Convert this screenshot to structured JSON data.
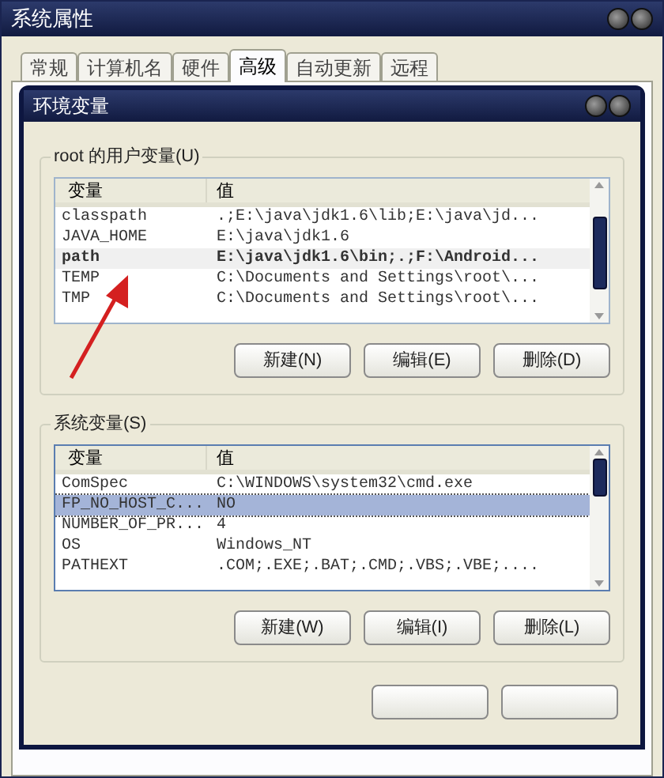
{
  "window": {
    "title": "系统属性"
  },
  "tabs": [
    {
      "label": "常规",
      "selected": false
    },
    {
      "label": "计算机名",
      "selected": false
    },
    {
      "label": "硬件",
      "selected": false
    },
    {
      "label": "高级",
      "selected": true
    },
    {
      "label": "自动更新",
      "selected": false
    },
    {
      "label": "远程",
      "selected": false
    }
  ],
  "dialog": {
    "title": "环境变量"
  },
  "groups": [
    {
      "title": "root 的用户变量(U)",
      "focused": false,
      "columns": [
        "变量",
        "值"
      ],
      "rows": [
        {
          "name": "classpath",
          "value": ".;E:\\java\\jdk1.6\\lib;E:\\java\\jd...",
          "selected": false
        },
        {
          "name": "JAVA_HOME",
          "value": "E:\\java\\jdk1.6",
          "selected": false
        },
        {
          "name": "path",
          "value": "E:\\java\\jdk1.6\\bin;.;F:\\Android...",
          "selected": true
        },
        {
          "name": "TEMP",
          "value": "C:\\Documents and Settings\\root\\...",
          "selected": false
        },
        {
          "name": "TMP",
          "value": "C:\\Documents and Settings\\root\\...",
          "selected": false
        }
      ],
      "buttons": [
        "新建(N)",
        "编辑(E)",
        "删除(D)"
      ]
    },
    {
      "title": "系统变量(S)",
      "focused": true,
      "columns": [
        "变量",
        "值"
      ],
      "rows": [
        {
          "name": "ComSpec",
          "value": "C:\\WINDOWS\\system32\\cmd.exe",
          "selected": false
        },
        {
          "name": "FP_NO_HOST_C...",
          "value": "NO",
          "selected": true
        },
        {
          "name": "NUMBER_OF_PR...",
          "value": "4",
          "selected": false
        },
        {
          "name": "OS",
          "value": "Windows_NT",
          "selected": false
        },
        {
          "name": "PATHEXT",
          "value": ".COM;.EXE;.BAT;.CMD;.VBS;.VBE;....",
          "selected": false
        }
      ],
      "buttons": [
        "新建(W)",
        "编辑(I)",
        "删除(L)"
      ]
    }
  ]
}
